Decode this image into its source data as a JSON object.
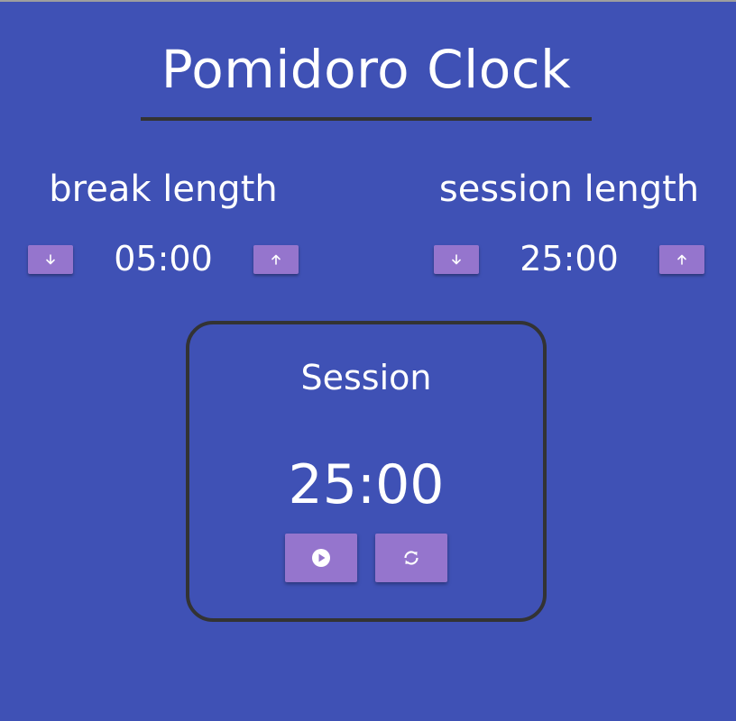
{
  "app": {
    "title": "Pomidoro Clock"
  },
  "break": {
    "label": "break length",
    "value": "05:00",
    "decrement_icon": "arrow-down-icon",
    "increment_icon": "arrow-up-icon"
  },
  "session": {
    "label": "session length",
    "value": "25:00",
    "decrement_icon": "arrow-down-icon",
    "increment_icon": "arrow-up-icon"
  },
  "timer": {
    "mode_label": "Session",
    "time": "25:00",
    "play_icon": "play-circle-icon",
    "reset_icon": "refresh-icon"
  },
  "colors": {
    "background": "#3f51b5",
    "button": "#9575cd",
    "border": "#333333",
    "text": "#ffffff"
  }
}
